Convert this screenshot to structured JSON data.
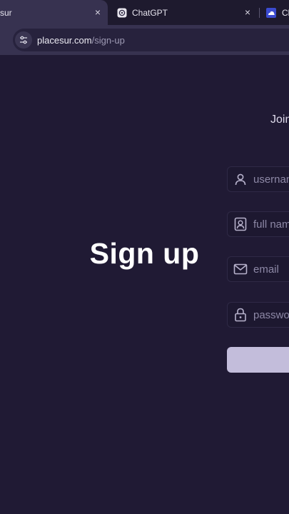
{
  "browser": {
    "tabs": [
      {
        "title": "sur",
        "active": true,
        "favicon": "site-icon"
      },
      {
        "title": "ChatGPT",
        "active": false,
        "favicon": "chatgpt-icon"
      },
      {
        "title": "Cl",
        "active": false,
        "favicon": "cloud-icon"
      }
    ],
    "close_glyph": "×",
    "url_host": "placesur.com",
    "url_path": "/sign-up"
  },
  "page": {
    "heading": "Sign up",
    "join_text": "Join",
    "fields": {
      "username_placeholder": "username",
      "fullname_placeholder": "full name",
      "email_placeholder": "email",
      "password_placeholder": "password"
    },
    "submit_label": ""
  },
  "colors": {
    "background": "#201a34",
    "tabstrip": "#1e1a2e",
    "toolbar": "#373250",
    "button": "#c3bddb"
  }
}
